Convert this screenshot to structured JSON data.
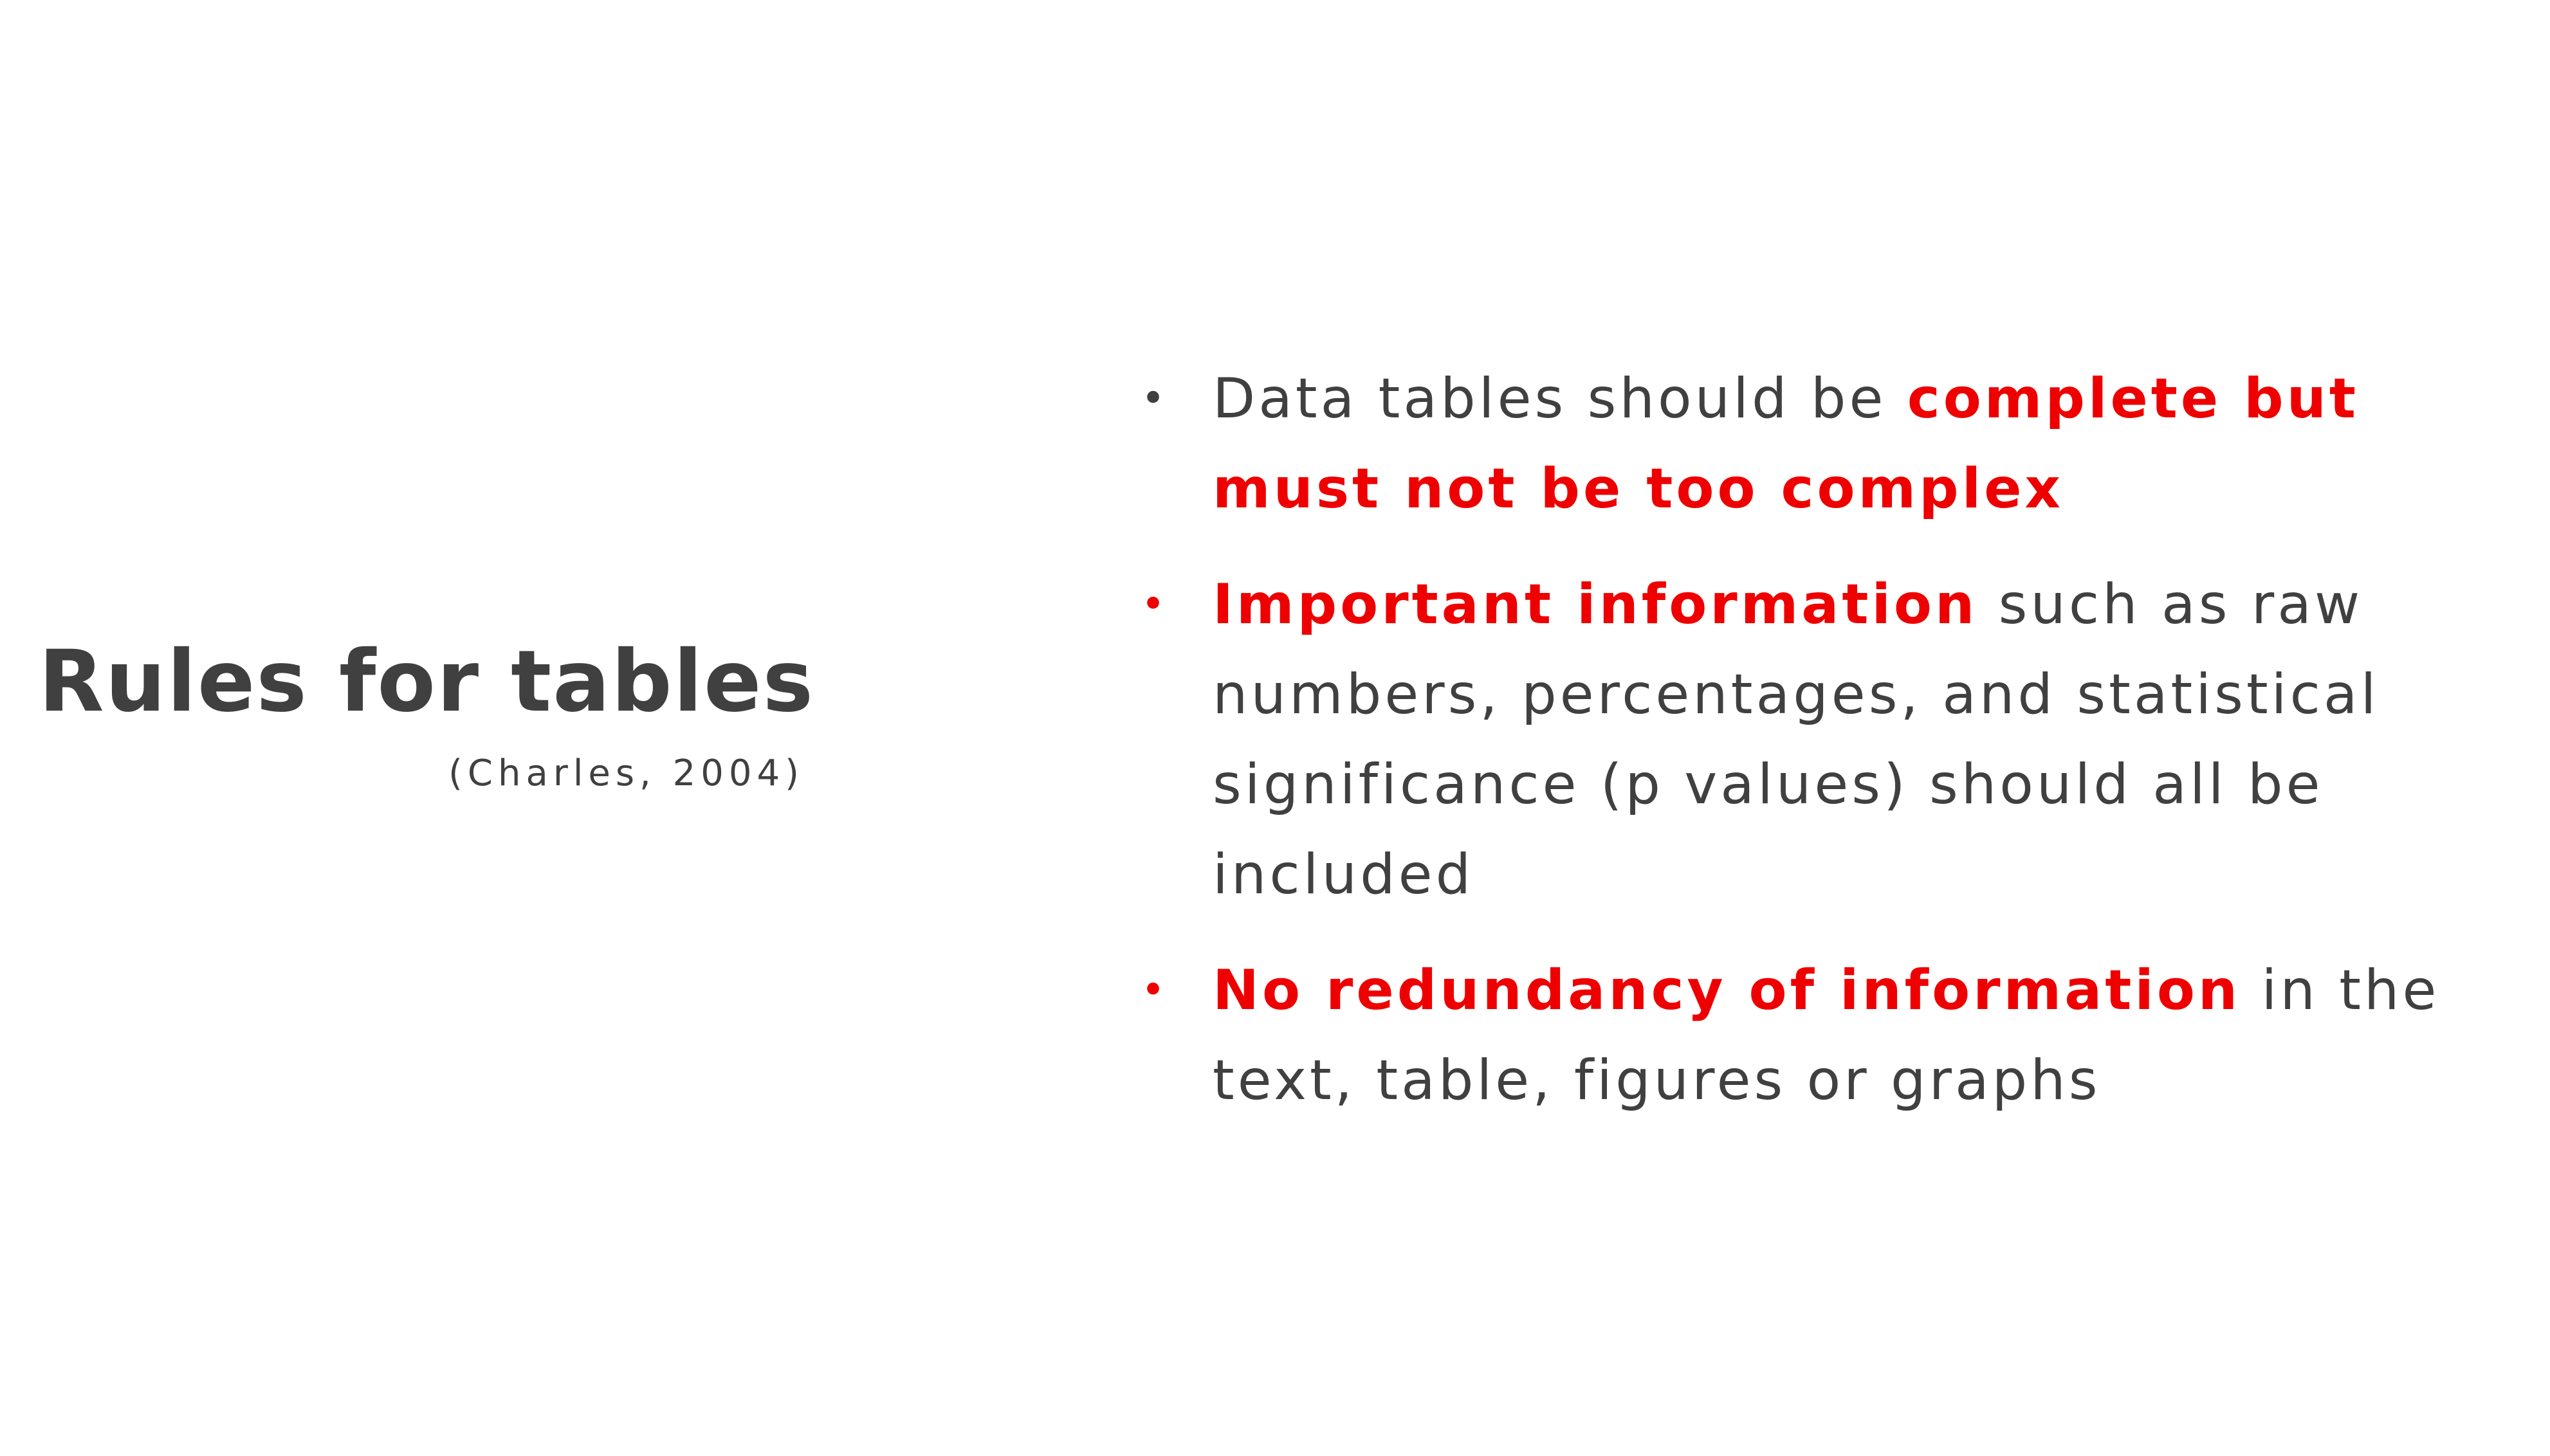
{
  "title": "Rules for tables",
  "citation": "(Charles, 2004)",
  "bullets": [
    {
      "marker": "•",
      "highlight": "complete but must not be too complex",
      "before": "Data tables should be ",
      "after": ""
    },
    {
      "marker": "•",
      "highlight": "Important information",
      "before": "",
      "after": " such as raw numbers, percentages, and statistical significance (p values) should all be included"
    },
    {
      "marker": "•",
      "highlight": "No redundancy of information",
      "before": "",
      "after": " in the text, table, figures or graphs"
    }
  ],
  "colors": {
    "text": "#404040",
    "highlight": "#ee0000",
    "background": "#ffffff"
  }
}
